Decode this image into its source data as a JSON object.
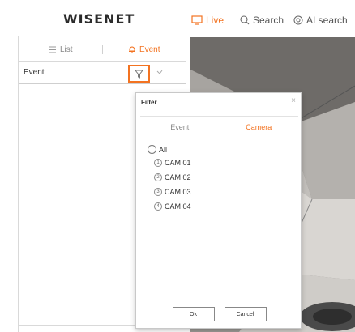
{
  "header": {
    "logo": "WISENET",
    "nav": [
      {
        "label": "Live",
        "icon": "monitor-icon",
        "active": true
      },
      {
        "label": "Search",
        "icon": "search-icon",
        "active": false
      },
      {
        "label": "AI search",
        "icon": "ai-search-icon",
        "active": false
      }
    ]
  },
  "sidebar": {
    "tabs": [
      {
        "label": "List",
        "icon": "list-icon",
        "active": false
      },
      {
        "label": "Event",
        "icon": "bell-icon",
        "active": true
      }
    ],
    "filter_label": "Event"
  },
  "dialog": {
    "title": "Filter",
    "close": "×",
    "tabs": [
      {
        "label": "Event",
        "active": false
      },
      {
        "label": "Camera",
        "active": true
      }
    ],
    "all_label": "All",
    "cameras": [
      {
        "num": "1",
        "label": "CAM 01"
      },
      {
        "num": "2",
        "label": "CAM 02"
      },
      {
        "num": "3",
        "label": "CAM 03"
      },
      {
        "num": "4",
        "label": "CAM 04"
      }
    ],
    "ok_label": "Ok",
    "cancel_label": "Cancel"
  },
  "colors": {
    "accent": "#f37321",
    "border": "#d9d9d9"
  }
}
